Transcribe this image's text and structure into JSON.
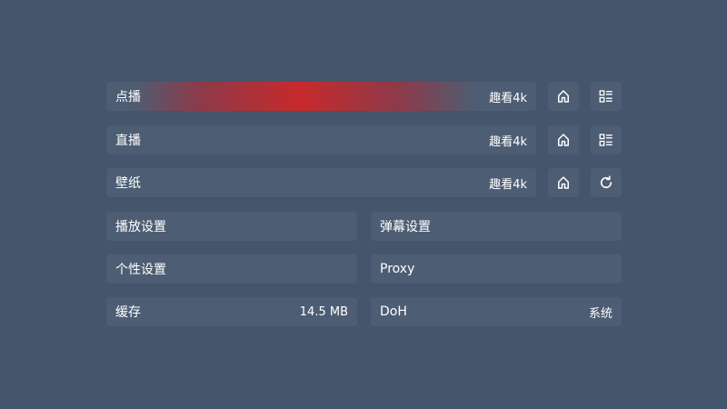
{
  "sources": [
    {
      "label": "点播",
      "value": "趣看4k",
      "icons": [
        "home-icon",
        "list-grid-icon"
      ]
    },
    {
      "label": "直播",
      "value": "趣看4k",
      "icons": [
        "home-icon",
        "list-grid-icon"
      ]
    },
    {
      "label": "壁纸",
      "value": "趣看4k",
      "icons": [
        "home-icon",
        "refresh-icon"
      ]
    }
  ],
  "settings": {
    "playback": {
      "label": "播放设置"
    },
    "danmaku": {
      "label": "弹幕设置"
    },
    "personal": {
      "label": "个性设置"
    },
    "proxy": {
      "label": "Proxy"
    },
    "cache": {
      "label": "缓存",
      "value": "14.5 MB"
    },
    "doh": {
      "label": "DoH",
      "value": "系统"
    }
  },
  "colors": {
    "background": "#44556c",
    "row": "#4d5d73",
    "focus_accent": "#c72a2b"
  }
}
